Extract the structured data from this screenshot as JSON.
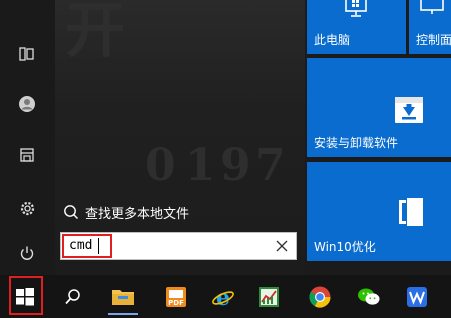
{
  "start_menu": {
    "search_result_label": "查找更多本地文件",
    "search_value": "cmd",
    "ghost_text": [
      "开",
      "0",
      "1",
      "9",
      "7"
    ]
  },
  "tiles": [
    {
      "label": "此电脑",
      "icon": "computer-icon"
    },
    {
      "label": "控制面",
      "icon": "control-panel-icon"
    },
    {
      "label": "安装与卸载软件",
      "icon": "install-box-icon"
    },
    {
      "label": "Win10优化",
      "icon": "optimize-icon"
    }
  ],
  "rail_icons": [
    "tablet-mode-icon",
    "user-icon",
    "documents-icon",
    "settings-icon",
    "power-icon"
  ],
  "taskbar_icons": [
    "windows-start-icon",
    "search-icon",
    "file-explorer-icon",
    "pdf-app-icon",
    "internet-explorer-icon",
    "chart-app-icon",
    "chrome-icon",
    "wechat-icon",
    "wps-icon"
  ],
  "colors": {
    "accent": "#0a6cce",
    "highlight": "#e02020",
    "background": "#1b1b1b"
  }
}
